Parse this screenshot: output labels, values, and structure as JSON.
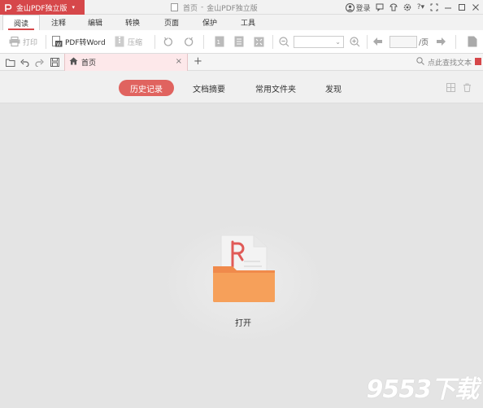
{
  "app": {
    "brand": "金山PDF独立版",
    "title": "首页 - 金山PDF独立版",
    "title_doc": "首页",
    "title_sep": "-",
    "title_app": "金山PDF独立版"
  },
  "titlebar": {
    "login": "登录",
    "help": "?"
  },
  "tabs": [
    {
      "label": "阅读",
      "active": true
    },
    {
      "label": "注释"
    },
    {
      "label": "编辑"
    },
    {
      "label": "转换"
    },
    {
      "label": "页面"
    },
    {
      "label": "保护"
    },
    {
      "label": "工具"
    }
  ],
  "toolbar": {
    "print": "打印",
    "pdf_to_word": "PDF转Word",
    "compress": "压缩",
    "page_unit": "/页",
    "zoom_value": "",
    "page_value": ""
  },
  "doc_tab": {
    "label": "首页"
  },
  "search": {
    "placeholder": "点此查找文本"
  },
  "home_nav": [
    {
      "label": "历史记录",
      "active": true
    },
    {
      "label": "文档摘要"
    },
    {
      "label": "常用文件夹"
    },
    {
      "label": "发现"
    }
  ],
  "open": {
    "label": "打开"
  },
  "watermark": "9553下载",
  "colors": {
    "brand": "#d6474a",
    "accent_pill": "#e0635f",
    "folder": "#f08a4b",
    "pdf_logo": "#e05a57"
  }
}
